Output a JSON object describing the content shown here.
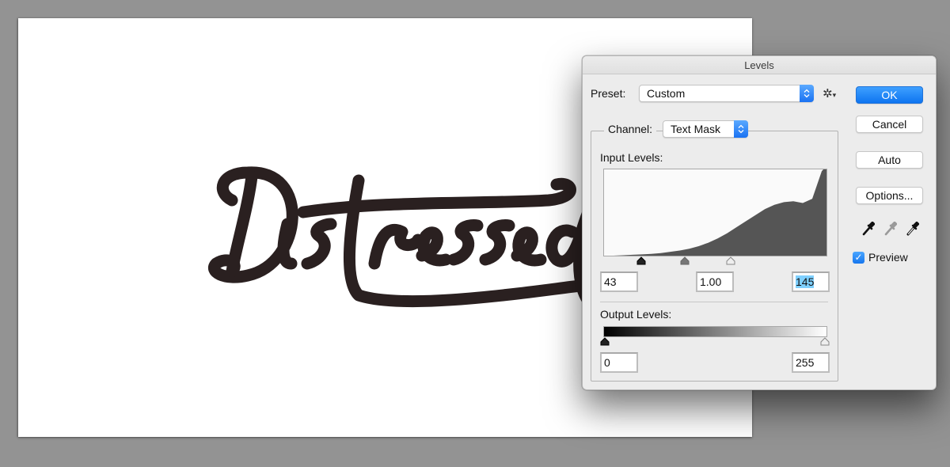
{
  "document": {
    "artwork_text": "Distressed",
    "artwork_color": "#2a2020"
  },
  "dialog": {
    "title": "Levels",
    "preset": {
      "label": "Preset:",
      "value": "Custom"
    },
    "preset_options_icon": "gear-icon",
    "channel": {
      "label": "Channel:",
      "value": "Text Mask"
    },
    "input_levels": {
      "label": "Input Levels:",
      "black": "43",
      "gamma": "1.00",
      "white": "145",
      "slider_fractions": {
        "black": 0.169,
        "gamma": 0.365,
        "white": 0.569
      },
      "histogram_profile": [
        0.0,
        0.0,
        0.005,
        0.01,
        0.015,
        0.02,
        0.03,
        0.045,
        0.06,
        0.08,
        0.11,
        0.15,
        0.2,
        0.26,
        0.33,
        0.4,
        0.47,
        0.54,
        0.59,
        0.62,
        0.63,
        0.61,
        0.66,
        0.98
      ]
    },
    "output_levels": {
      "label": "Output Levels:",
      "black": "0",
      "white": "255"
    },
    "buttons": {
      "ok": "OK",
      "cancel": "Cancel",
      "auto": "Auto",
      "options": "Options..."
    },
    "eyedroppers": [
      "black-point-eyedropper",
      "gray-point-eyedropper",
      "white-point-eyedropper"
    ],
    "preview": {
      "label": "Preview",
      "checked": true
    },
    "colors": {
      "accent": "#1a7ef5",
      "selection": "#7fd0ff",
      "histogram_fill": "#555555"
    }
  }
}
